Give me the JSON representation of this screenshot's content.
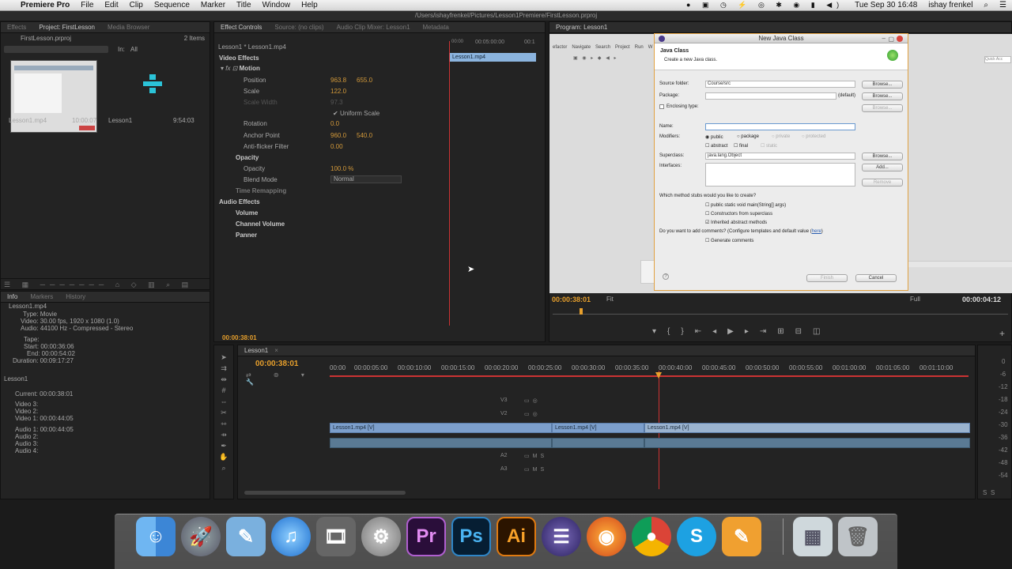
{
  "menubar": {
    "apple": "",
    "app": "Premiere Pro",
    "items": [
      "File",
      "Edit",
      "Clip",
      "Sequence",
      "Marker",
      "Title",
      "Window",
      "Help"
    ],
    "time": "Tue Sep 30  16:48",
    "user": "ishay frenkel"
  },
  "window_path": "/Users/ishayfrenkel/Pictures/Lesson1Premiere/FirstLesson.prproj",
  "project": {
    "tabs": [
      "Effects",
      "Project: FirstLesson",
      "Media Browser"
    ],
    "file": "FirstLesson.prproj",
    "count": "2 Items",
    "in_label": "In:",
    "in_value": "All",
    "items": [
      {
        "name": "Lesson1.mp4",
        "duration": "10:00:07"
      },
      {
        "name": "Lesson1",
        "duration": "9:54:03"
      }
    ]
  },
  "info": {
    "tabs": [
      "Info",
      "Markers",
      "History"
    ],
    "clip": "Lesson1.mp4",
    "type": "Type: Movie",
    "video": "Video: 30.00 fps, 1920 x 1080 (1.0)",
    "audio": "Audio: 44100 Hz - Compressed - Stereo",
    "tape": "Tape:",
    "start": "Start: 00:00:36:06",
    "end": "End: 00:00:54:02",
    "duration": "Duration: 00:09:17:27",
    "seq": "Lesson1",
    "current": "Current: 00:00:38:01",
    "v3": "Video 3:",
    "v2": "Video 2:",
    "v1": "Video 1: 00:00:44:05",
    "a1": "Audio 1: 00:00:44:05",
    "a2": "Audio 2:",
    "a3": "Audio 3:",
    "a4": "Audio 4:"
  },
  "effects": {
    "tabs": [
      "Effect Controls",
      "Source: (no clips)",
      "Audio Clip Mixer: Lesson1",
      "Metadata"
    ],
    "clip_path": "Lesson1 * Lesson1.mp4",
    "ruler_a": "00:00",
    "ruler_b": "00:05:00:00",
    "ruler_c": "00:1",
    "clip_label": "Lesson1.mp4",
    "video_effects": "Video Effects",
    "motion": "Motion",
    "position": "Position",
    "pos_x": "963.8",
    "pos_y": "655.0",
    "scale": "Scale",
    "scale_v": "122.0",
    "scale_width": "Scale Width",
    "scale_width_v": "97.3",
    "uniform": "Uniform Scale",
    "rotation": "Rotation",
    "rotation_v": "0.0",
    "anchor": "Anchor Point",
    "anchor_x": "960.0",
    "anchor_y": "540.0",
    "antiflicker": "Anti-flicker Filter",
    "antiflicker_v": "0.00",
    "opacity_grp": "Opacity",
    "opacity": "Opacity",
    "opacity_v": "100.0 %",
    "blend": "Blend Mode",
    "blend_v": "Normal",
    "time_remap": "Time Remapping",
    "audio_effects": "Audio Effects",
    "volume": "Volume",
    "channel_volume": "Channel Volume",
    "panner": "Panner",
    "timecode": "00:00:38:01"
  },
  "program": {
    "tab": "Program: Lesson1",
    "timecode": "00:00:38:01",
    "fit": "Fit",
    "full": "Full",
    "duration": "00:00:04:12"
  },
  "dialog": {
    "title": "New Java Class",
    "heading": "Java Class",
    "subtitle": "Create a new Java class.",
    "source_folder_label": "Source folder:",
    "source_folder": "Course/src",
    "package_label": "Package:",
    "package_default": "(default)",
    "enclosing": "Enclosing type:",
    "name_label": "Name:",
    "modifiers_label": "Modifiers:",
    "mod_public": "public",
    "mod_package": "package",
    "mod_private": "private",
    "mod_protected": "protected",
    "mod_abstract": "abstract",
    "mod_final": "final",
    "mod_static": "static",
    "superclass_label": "Superclass:",
    "superclass": "java.lang.Object",
    "interfaces_label": "Interfaces:",
    "browse": "Browse...",
    "add": "Add...",
    "remove": "Remove",
    "stubs_q": "Which method stubs would you like to create?",
    "stub1": "public static void main(String[] args)",
    "stub2": "Constructors from superclass",
    "stub3": "Inherited abstract methods",
    "comments_q": "Do you want to add comments? (Configure templates and default value",
    "here": "here",
    "comments_q_end": ")",
    "gen_comments": "Generate comments",
    "finish": "Finish",
    "cancel": "Cancel"
  },
  "eclipse": {
    "menu": [
      "efactor",
      "Navigate",
      "Search",
      "Project",
      "Run",
      "W"
    ],
    "quick": "Quick Acc"
  },
  "timeline": {
    "tab": "Lesson1",
    "timecode": "00:00:38:01",
    "ruler": [
      "00:00",
      "00:00:05:00",
      "00:00:10:00",
      "00:00:15:00",
      "00:00:20:00",
      "00:00:25:00",
      "00:00:30:00",
      "00:00:35:00",
      "00:00:40:00",
      "00:00:45:00",
      "00:00:50:00",
      "00:00:55:00",
      "00:01:00:00",
      "00:01:05:00",
      "00:01:10:00"
    ],
    "tracks": [
      "V3",
      "V2",
      "V1",
      "A1",
      "A2",
      "A3"
    ],
    "clip1": "Lesson1.mp4 [V]",
    "clip2": "Lesson1.mp4 [V]",
    "clip3": "Lesson1.mp4 [V]",
    "meter": [
      "0",
      "-6",
      "-12",
      "-18",
      "-24",
      "-30",
      "-36",
      "-42",
      "-48",
      "-54"
    ],
    "meter_s": "S",
    "meter_s2": "S"
  },
  "dock": [
    "Finder",
    "Launchpad",
    "Preview",
    "iTunes",
    "DVD Player",
    "System Preferences",
    "Premiere Pro",
    "Photoshop",
    "Illustrator",
    "Eclipse",
    "Firefox",
    "Chrome",
    "Skype",
    "Pages",
    "Downloads",
    "Trash"
  ],
  "dock_labels": {
    "pr": "Pr",
    "ps": "Ps",
    "ai": "Ai",
    "s": "S"
  }
}
